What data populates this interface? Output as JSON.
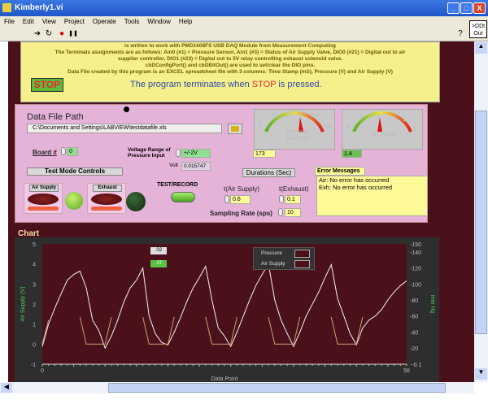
{
  "window": {
    "title": "Kimberly1.vi",
    "min": "_",
    "max": "□",
    "close": "X"
  },
  "menu": [
    "File",
    "Edit",
    "View",
    "Project",
    "Operate",
    "Tools",
    "Window",
    "Help"
  ],
  "toolbar": {
    "run": "➜",
    "run_cont": "↻",
    "abort": "●",
    "pause": "❚❚",
    "help": "?"
  },
  "ddt": {
    "line1": ">DDt",
    "line2": "Out"
  },
  "info": {
    "lines": [
      "is written to work with PMD1608FS USB DAQ Module from Measurement Computing",
      "The Terminals assignments are as follows: Ain0 (#1) = Pressure Sensor, Ain1 (#3) = Status of Air Supply Valve, DIO0 (#21) = Digital out to air",
      "supplier controller, DIO1 (#23) = Digital out to 5V relay controlling exhaust solenoid valve.",
      "cbDConfigPort() and cbDBitOut() are used to set/clear the DIO pins.",
      "Data File created by this program is an EXCEL spreadsheet file with 3 columns: Time Stamp (mS), Pressure (V) and Air Supply (V)"
    ],
    "stop_label": "STOP",
    "term_pre": "The program terminates when ",
    "term_stop": "STOP",
    "term_post": " is pressed."
  },
  "panel": {
    "file_path_label": "Data File Path",
    "file_path": "C:\\Documents and Settings\\LABVIEW\\testdatafile.xls",
    "board_label": "Board #",
    "board_value": "0",
    "vrange_label1": "Voltage Range of",
    "vrange_label2": "Pressure Input",
    "vrange_value": "+/-2V",
    "volt_label": "Volt",
    "volt_value": "0.015747",
    "test_mode": "Test Mode Controls",
    "air_supply": "Air Supply",
    "exhaust": "Exhaust",
    "test_record": "TEST/RECORD",
    "pressure_gauge": {
      "label1": "Pressure",
      "label2": "(mm Hg)",
      "ticks": [
        "-1",
        "50",
        "100",
        "150",
        "200",
        "250"
      ],
      "value": "173"
    },
    "air_gauge": {
      "label": "Air Supply",
      "ticks": [
        "-1",
        "0",
        "1",
        "2",
        "3",
        "4",
        "5"
      ],
      "value": "1.4"
    },
    "durations": "Durations (Sec)",
    "t_air_label": "t(Air Supply)",
    "t_air": "0.6",
    "t_exh_label": "t(Exhaust)",
    "t_exh": "0.1",
    "rate_label": "Sampling Rate (sps)",
    "rate": "10",
    "err_label": "Error Messages",
    "err1": "Air: No error has occurred",
    "err2": "Exh: No error has occurred"
  },
  "chart_title": "Chart",
  "chart_data": {
    "type": "line",
    "xlabel": "Data Point",
    "ylabel_left": "Air Supply (V)",
    "ylabel_right": "mm Hg",
    "xlim": [
      0,
      58
    ],
    "ylim_left": [
      -1,
      5
    ],
    "ylim_right": [
      -0.1,
      150
    ],
    "xticks": [
      "0",
      "58"
    ],
    "yticks_left": [
      "-1",
      "0",
      "1",
      "2",
      "3",
      "4",
      "5"
    ],
    "yticks_right": [
      "-0.1",
      "20",
      "40",
      "60",
      "80",
      "100",
      "120",
      "140",
      "150"
    ],
    "cursor_values": [
      ".02",
      ".37"
    ],
    "legend": [
      "Pressure",
      "Air Supply"
    ],
    "colors": {
      "Pressure": "#f4f0f0",
      "Air Supply": "#c8a070"
    },
    "series": [
      {
        "name": "Pressure",
        "axis": "right",
        "values": [
          22,
          50,
          70,
          88,
          105,
          112,
          116,
          95,
          55,
          42,
          20,
          35,
          55,
          78,
          95,
          105,
          120,
          60,
          38,
          27,
          24,
          40,
          58,
          78,
          95,
          108,
          122,
          80,
          45,
          35,
          22,
          40,
          60,
          80,
          98,
          112,
          125,
          80,
          55,
          38,
          22,
          40,
          60,
          75,
          90,
          108,
          124,
          82,
          60,
          38,
          24,
          45,
          55,
          60,
          68,
          80,
          90,
          98,
          104
        ]
      },
      {
        "name": "Air Supply",
        "axis": "left",
        "values": [
          0,
          1.2,
          null,
          null,
          null,
          null,
          1.35,
          0,
          0,
          0,
          0,
          1.35,
          null,
          null,
          null,
          null,
          1.35,
          0,
          0,
          0,
          0,
          1.35,
          null,
          null,
          null,
          null,
          1.35,
          0,
          0,
          0,
          0,
          1.35,
          null,
          null,
          null,
          null,
          1.35,
          0,
          0,
          0,
          0,
          1.35,
          null,
          null,
          null,
          null,
          1.35,
          0,
          0,
          0,
          0,
          1.35,
          null,
          null,
          null,
          null,
          null,
          null,
          null
        ]
      }
    ]
  }
}
